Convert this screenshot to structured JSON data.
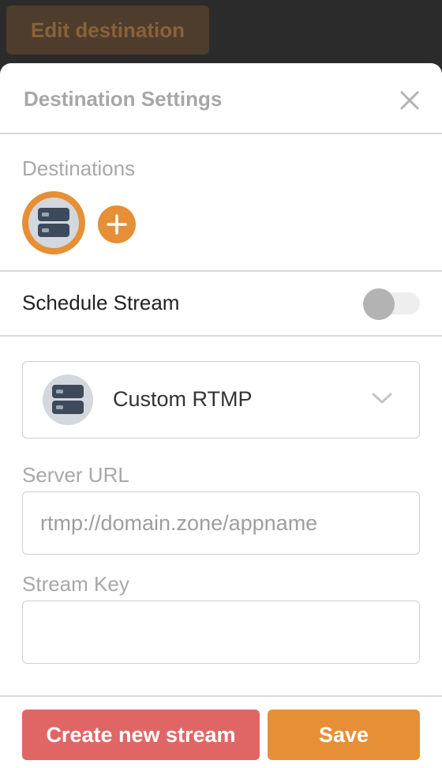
{
  "topbar": {
    "edit_button_label": "Edit destination"
  },
  "panel": {
    "title": "Destination Settings",
    "close_icon": "close-icon"
  },
  "destinations": {
    "label": "Destinations",
    "items": [
      {
        "icon": "server-icon",
        "selected": true
      }
    ],
    "add_icon": "plus-icon"
  },
  "schedule": {
    "label": "Schedule Stream",
    "enabled": false
  },
  "platform_select": {
    "icon": "server-icon",
    "selected_label": "Custom RTMP",
    "dropdown_icon": "chevron-down-icon"
  },
  "server_url": {
    "label": "Server URL",
    "value": "",
    "placeholder": "rtmp://domain.zone/appname"
  },
  "stream_key": {
    "label": "Stream Key",
    "value": "",
    "placeholder": ""
  },
  "footer": {
    "create_label": "Create new stream",
    "save_label": "Save"
  },
  "colors": {
    "accent": "#e68f37",
    "danger": "#e06666",
    "icon_dark": "#3c4a5c",
    "icon_bg": "#d3d7de"
  }
}
